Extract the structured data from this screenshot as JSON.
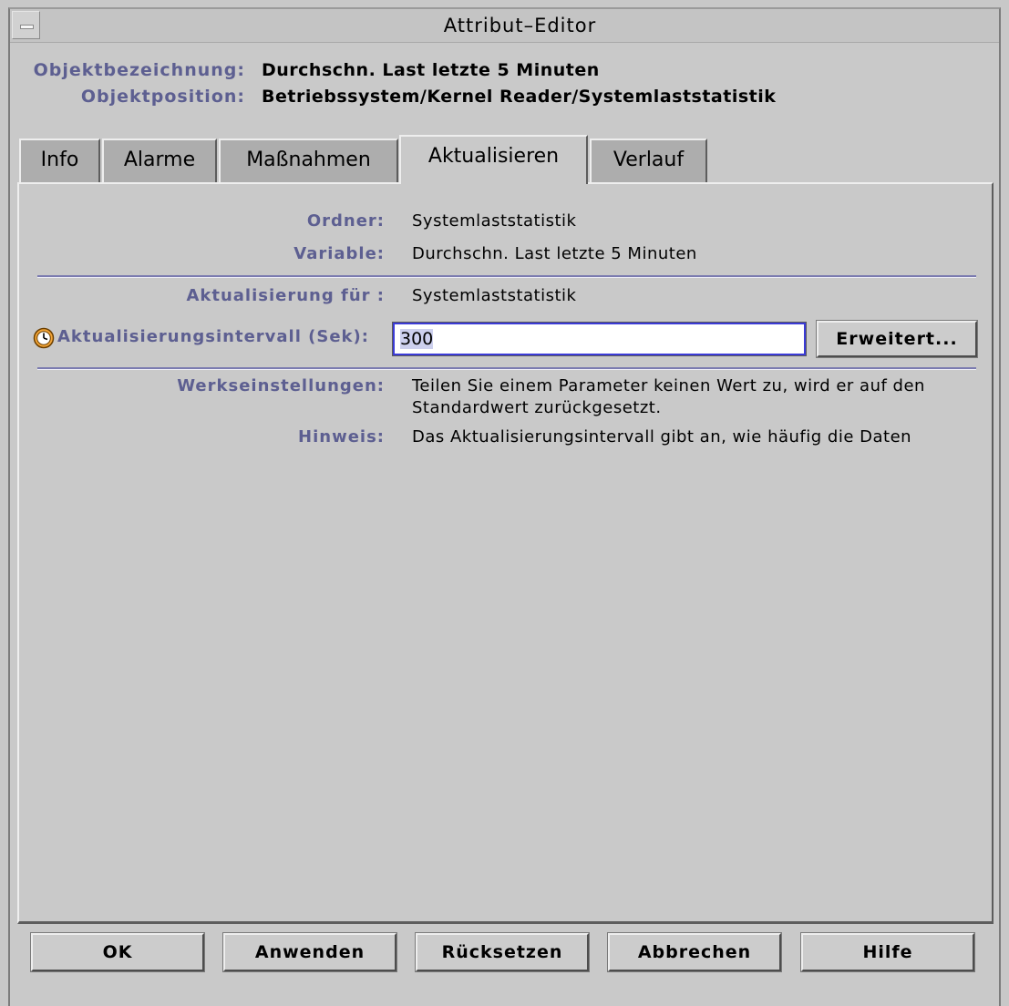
{
  "window": {
    "title": "Attribut–Editor"
  },
  "object": {
    "name_label": "Objektbezeichnung:",
    "name_value": "Durchschn. Last letzte 5 Minuten",
    "position_label": "Objektposition:",
    "position_value": "Betriebssystem/Kernel Reader/Systemlaststatistik"
  },
  "tabs": [
    {
      "label": "Info",
      "active": false
    },
    {
      "label": "Alarme",
      "active": false
    },
    {
      "label": "Maßnahmen",
      "active": false
    },
    {
      "label": "Aktualisieren",
      "active": true
    },
    {
      "label": "Verlauf",
      "active": false
    }
  ],
  "panel": {
    "folder_label": "Ordner:",
    "folder_value": "Systemlaststatistik",
    "variable_label": "Variable:",
    "variable_value": "Durchschn. Last letzte 5 Minuten",
    "update_for_label": "Aktualisierung für :",
    "update_for_value": "Systemlaststatistik",
    "interval_label": "Aktualisierungsintervall (Sek):",
    "interval_value": "300",
    "advanced_button": "Erweitert...",
    "defaults_label": "Werkseinstellungen:",
    "defaults_line1": "Teilen Sie einem Parameter keinen Wert zu, wird er auf den",
    "defaults_line2": "Standardwert zurückgesetzt.",
    "hint_label": "Hinweis:",
    "hint_value": "Das Aktualisierungsintervall gibt an, wie häufig die Daten"
  },
  "buttons": {
    "ok": "OK",
    "apply": "Anwenden",
    "reset": "Rücksetzen",
    "cancel": "Abbrechen",
    "help": "Hilfe"
  },
  "icons": {
    "interval": "clock-icon",
    "window_menu": "window-menu-icon"
  },
  "colors": {
    "label_blue": "#5d5f91",
    "input_border": "#3b3bd6",
    "separator": "#7b7bb0"
  }
}
